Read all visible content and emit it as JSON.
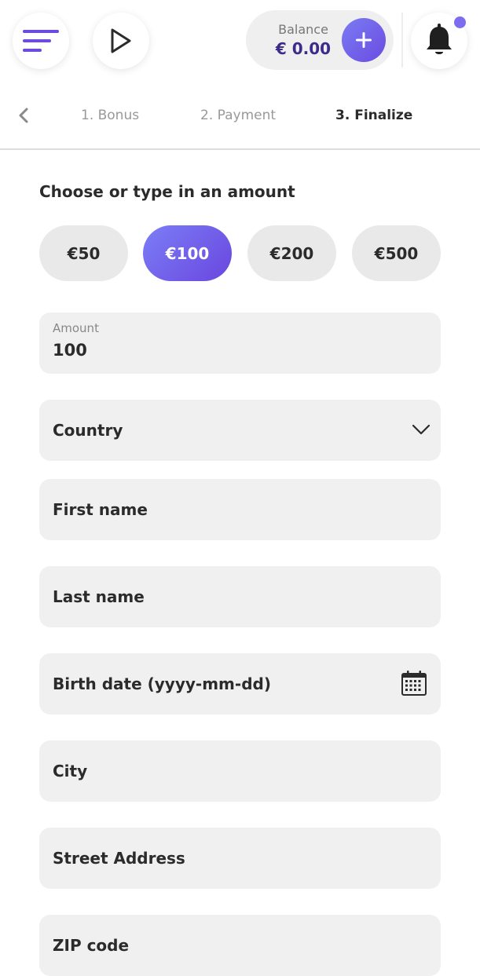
{
  "header": {
    "balance_label": "Balance",
    "balance_value": "€ 0.00",
    "icons": {
      "menu": "hamburger-menu-icon",
      "play": "play-icon",
      "add": "plus-icon",
      "notifications": "bell-icon"
    }
  },
  "steps": {
    "items": [
      {
        "label": "1. Bonus",
        "active": false
      },
      {
        "label": "2. Payment",
        "active": false
      },
      {
        "label": "3. Finalize",
        "active": true
      }
    ]
  },
  "form": {
    "title": "Choose or type in an amount",
    "amount_options": [
      {
        "label": "€50",
        "selected": false
      },
      {
        "label": "€100",
        "selected": true
      },
      {
        "label": "€200",
        "selected": false
      },
      {
        "label": "€500",
        "selected": false
      }
    ],
    "amount_field": {
      "label": "Amount",
      "value": "100"
    },
    "country_field": {
      "label": "Country"
    },
    "first_name_field": {
      "label": "First name"
    },
    "last_name_field": {
      "label": "Last name"
    },
    "birth_date_field": {
      "label": "Birth date (yyyy-mm-dd)"
    },
    "city_field": {
      "label": "City"
    },
    "street_field": {
      "label": "Street Address"
    },
    "zip_field": {
      "label": "ZIP code"
    }
  },
  "colors": {
    "accent": "#6b4be0",
    "accent_light": "#7b7ef6",
    "balance_text": "#3d2a8a",
    "field_bg": "#f0f0f0",
    "chip_bg": "#e9e9e9"
  }
}
